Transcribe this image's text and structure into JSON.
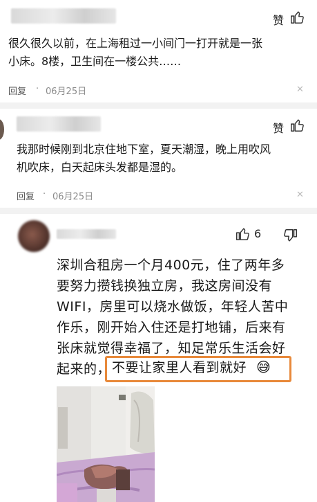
{
  "comments": [
    {
      "like_label": "赞",
      "text_line1": "很久很久以前，在上海租过一小间门一打开就是一张",
      "text_line2": "小床。8楼，卫生间在一楼公共……",
      "reply_label": "回复",
      "date": "06月25日"
    },
    {
      "like_label": "赞",
      "text_line1": "我那时候刚到北京住地下室，夏天潮湿，晚上用吹风",
      "text_line2": "机吹床，白天起床头发都是湿的。",
      "reply_label": "回复",
      "date": "06月25日"
    }
  ],
  "main_post": {
    "like_count": "6",
    "lines": [
      "深圳合租房一个月400元，住了两年多",
      "要努力攒钱换独立房，我这房间没有",
      "WIFI，房里可以烧水做饭，年轻人苦中",
      "作乐，刚开始入住还是打地铺，后来有",
      "张床就觉得幸福了，知足常乐生活会好"
    ],
    "last_line_prefix": "起来的，",
    "highlight_text": "不要让家里人看到就好",
    "emoji": "😅"
  },
  "icons": [
    "thumb-up-icon",
    "thumb-down-icon",
    "close-icon"
  ],
  "colors": {
    "highlight_border": "#e8893a"
  }
}
